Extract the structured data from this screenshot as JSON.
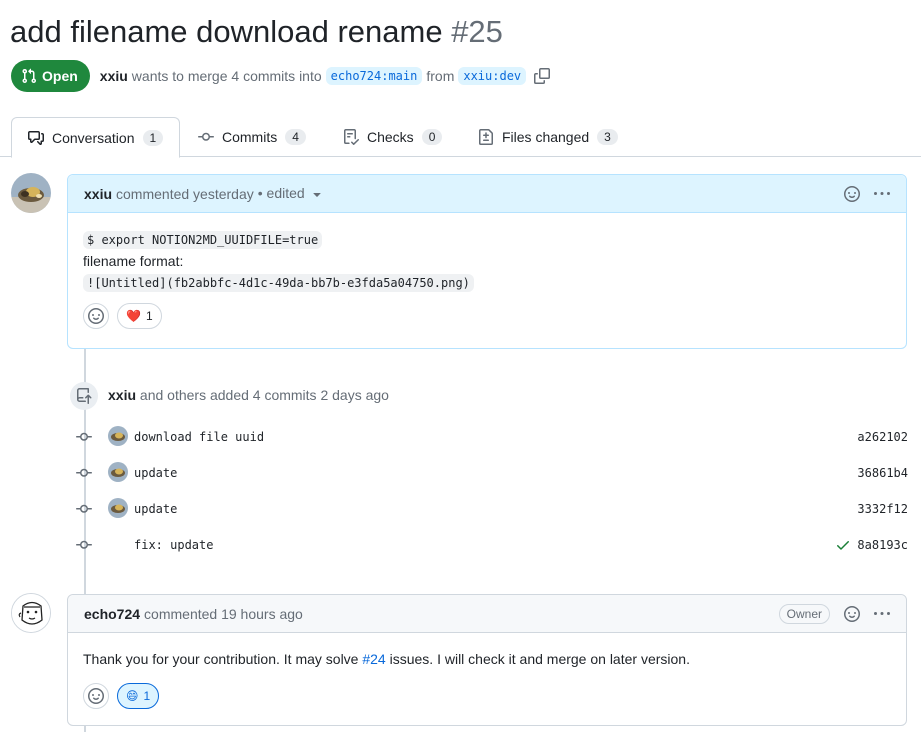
{
  "title": {
    "text": "add filename download rename",
    "number": "#25"
  },
  "status": {
    "state": "Open",
    "author": "xxiu",
    "text_before": "wants to merge 4 commits into",
    "base_branch": "echo724:main",
    "from_text": "from",
    "head_branch": "xxiu:dev"
  },
  "tabs": [
    {
      "label": "Conversation",
      "count": "1",
      "icon": "comment-discussion-icon"
    },
    {
      "label": "Commits",
      "count": "4",
      "icon": "git-commit-icon"
    },
    {
      "label": "Checks",
      "count": "0",
      "icon": "checklist-icon"
    },
    {
      "label": "Files changed",
      "count": "3",
      "icon": "file-diff-icon"
    }
  ],
  "comment1": {
    "author": "xxiu",
    "meta": "commented yesterday",
    "edited": "• edited",
    "code_line": "$ export NOTION2MD_UUIDFILE=true",
    "text_line": "filename format:",
    "code_line2": "![Untitled](fb2abbfc-4d1c-49da-bb7b-e3fda5a04750.png)",
    "reaction_emoji": "❤️",
    "reaction_count": "1"
  },
  "push": {
    "author": "xxiu",
    "text": "and others added 4 commits 2 days ago"
  },
  "commits": [
    {
      "message": "download file uuid",
      "sha": "a262102",
      "has_avatar": true,
      "verified": false
    },
    {
      "message": "update",
      "sha": "36861b4",
      "has_avatar": true,
      "verified": false
    },
    {
      "message": "update",
      "sha": "3332f12",
      "has_avatar": true,
      "verified": false
    },
    {
      "message": "fix: update",
      "sha": "8a8193c",
      "has_avatar": false,
      "verified": true
    }
  ],
  "comment2": {
    "author": "echo724",
    "meta": "commented 19 hours ago",
    "role": "Owner",
    "text_before": "Thank you for your contribution. It may solve",
    "issue_link": "#24",
    "text_after": "issues. I will check it and merge on later version.",
    "reaction_emoji": "😄",
    "reaction_count": "1"
  },
  "colors": {
    "open_green": "#1f883d",
    "link_blue": "#0969da",
    "header_blue": "#ddf4ff",
    "border": "#d0d7de"
  }
}
